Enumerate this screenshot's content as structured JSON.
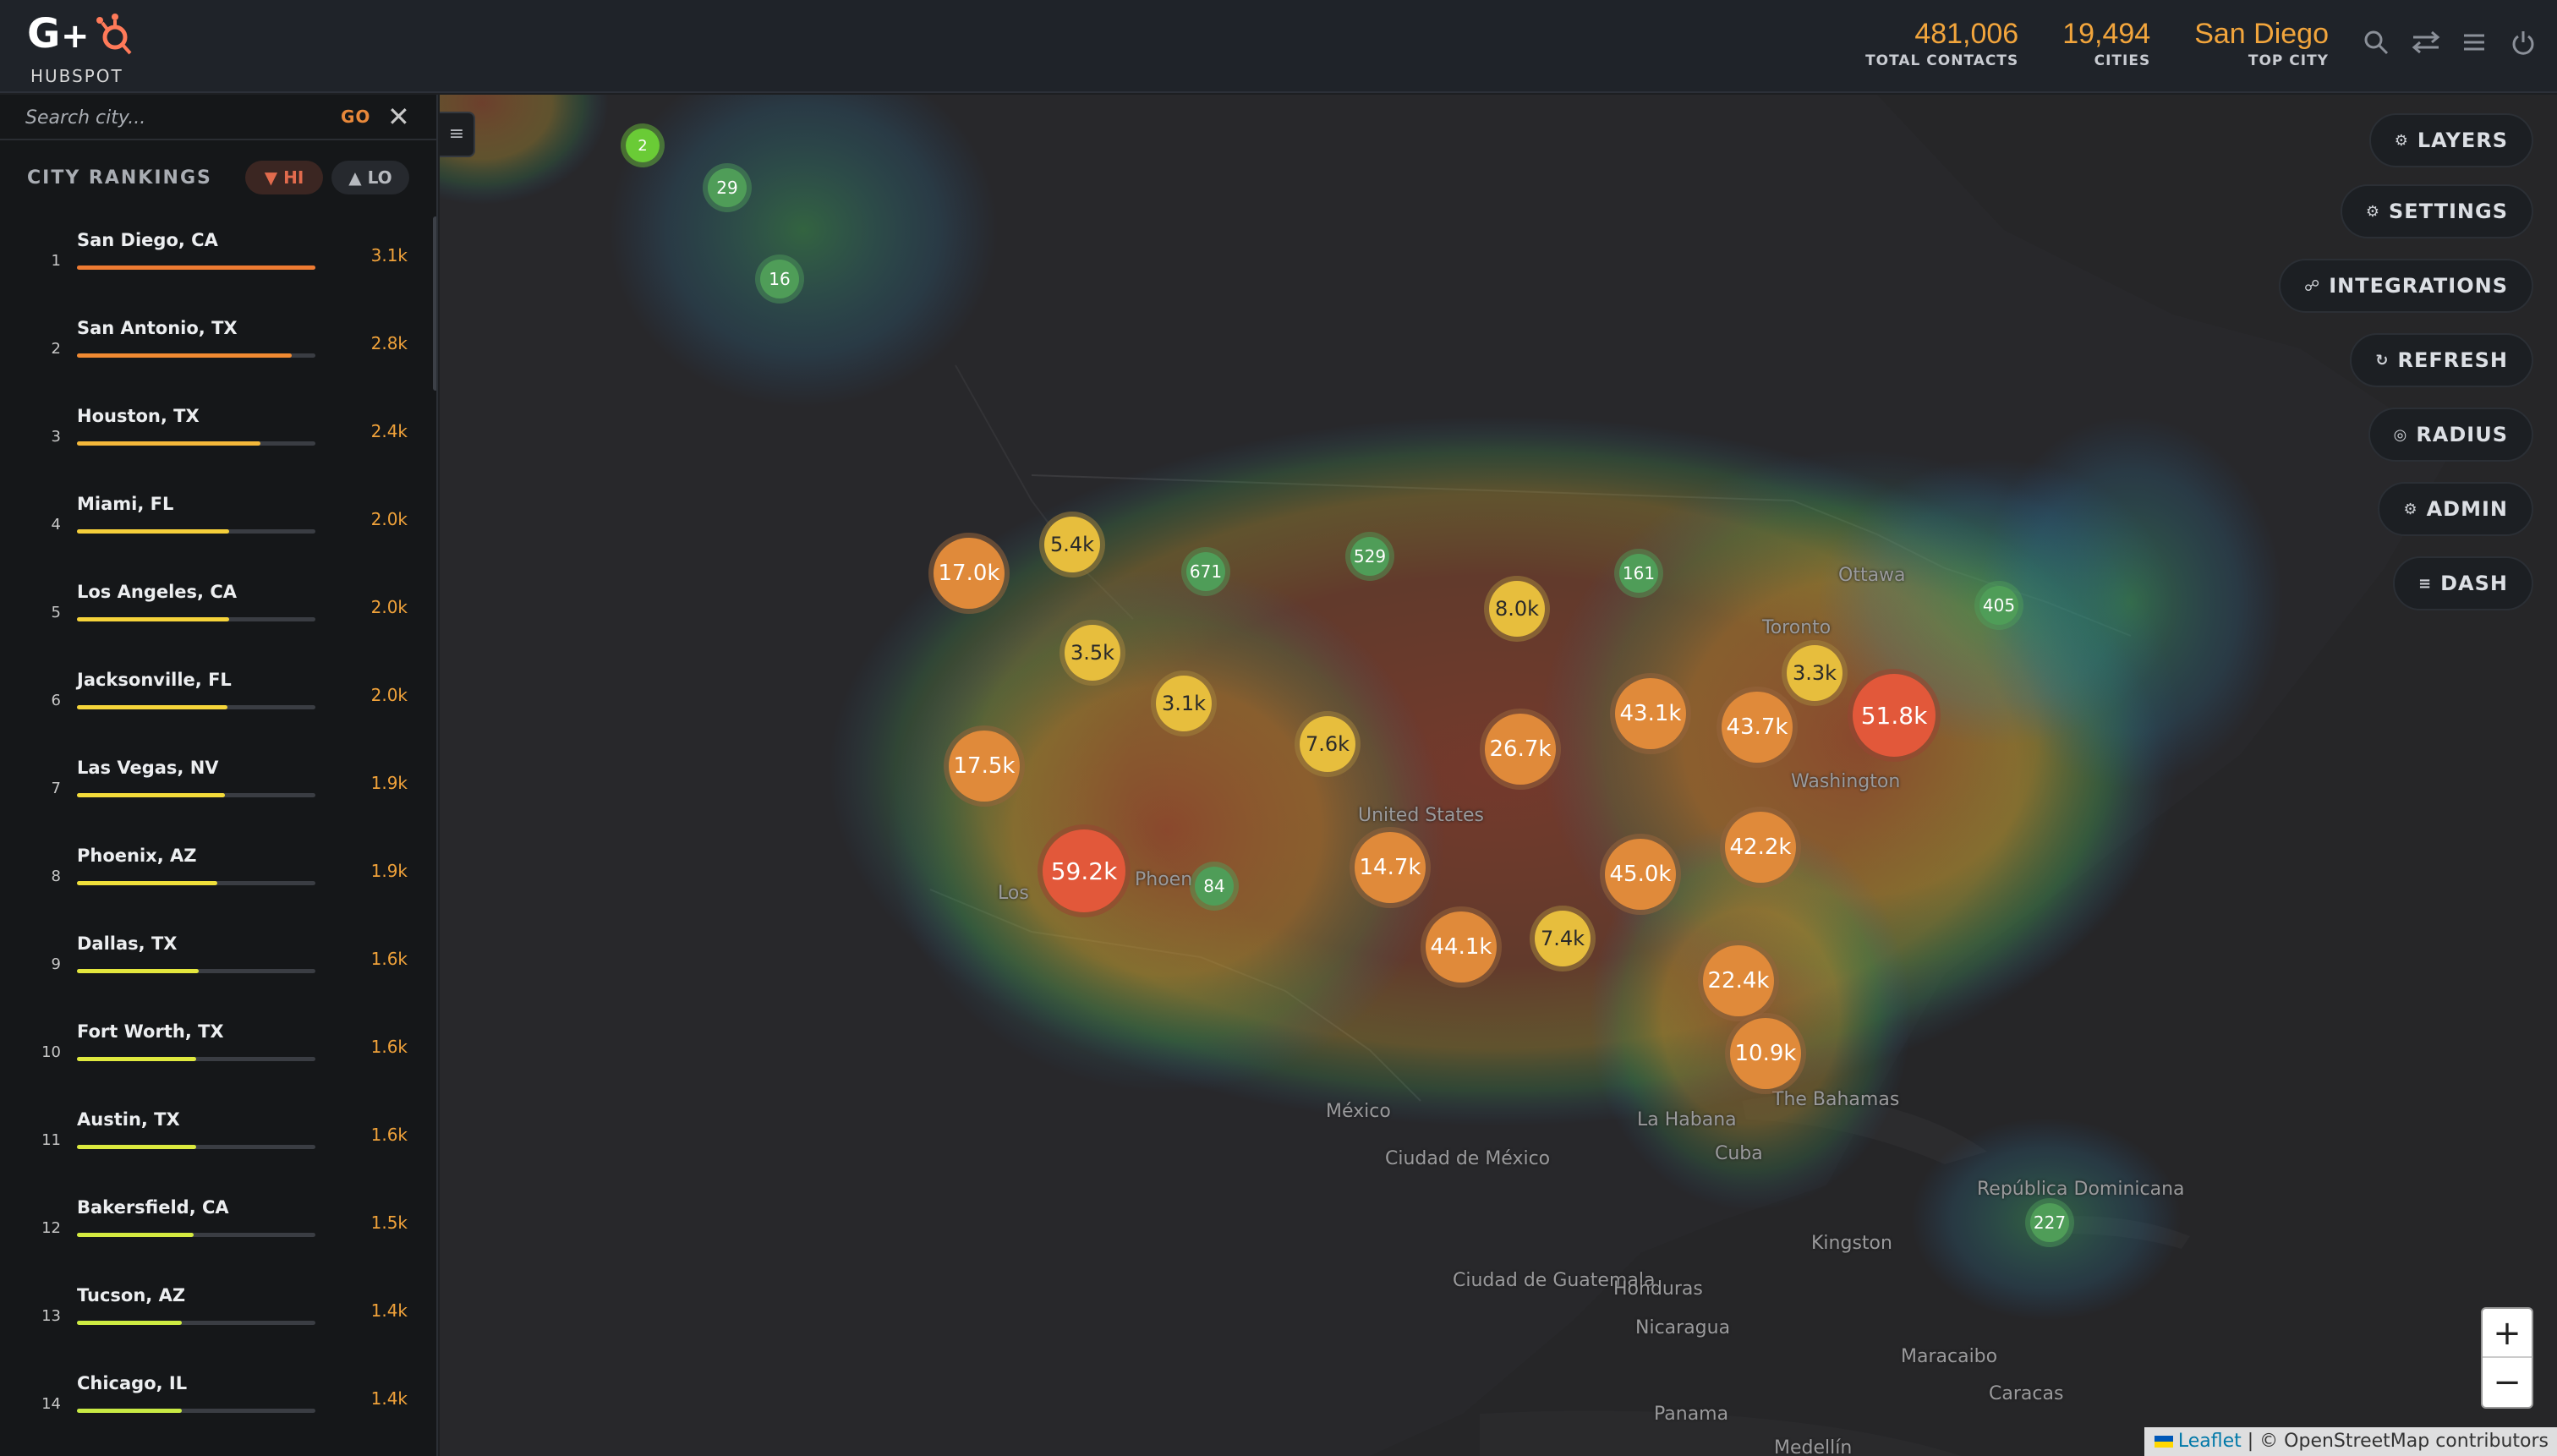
{
  "header": {
    "brand_text": "HUBSPOT",
    "logo_text": "G+",
    "stats": [
      {
        "value": "481,006",
        "label": "TOTAL CONTACTS"
      },
      {
        "value": "19,494",
        "label": "CITIES"
      },
      {
        "value": "San Diego",
        "label": "TOP CITY"
      }
    ],
    "icons": [
      "search-icon",
      "swap-icon",
      "menu-icon",
      "power-icon"
    ]
  },
  "sidebar": {
    "search": {
      "placeholder": "Search city...",
      "go_label": "GO",
      "clear_label": "✕"
    },
    "rankings_title": "CITY RANKINGS",
    "sort_hi_label": "▼ HI",
    "sort_lo_label": "▲ LO",
    "cities": [
      {
        "rank": "1",
        "name": "San Diego, CA",
        "value": "3.1k",
        "bar": 1.0,
        "color": "#ee7b32"
      },
      {
        "rank": "2",
        "name": "San Antonio, TX",
        "value": "2.8k",
        "bar": 0.9,
        "color": "#f08a32"
      },
      {
        "rank": "3",
        "name": "Houston, TX",
        "value": "2.4k",
        "bar": 0.77,
        "color": "#f4b83a"
      },
      {
        "rank": "4",
        "name": "Miami, FL",
        "value": "2.0k",
        "bar": 0.64,
        "color": "#f5cf3a"
      },
      {
        "rank": "5",
        "name": "Los Angeles, CA",
        "value": "2.0k",
        "bar": 0.64,
        "color": "#f5d33a"
      },
      {
        "rank": "6",
        "name": "Jacksonville, FL",
        "value": "2.0k",
        "bar": 0.63,
        "color": "#f5d53a"
      },
      {
        "rank": "7",
        "name": "Las Vegas, NV",
        "value": "1.9k",
        "bar": 0.62,
        "color": "#f3db3a"
      },
      {
        "rank": "8",
        "name": "Phoenix, AZ",
        "value": "1.9k",
        "bar": 0.59,
        "color": "#efdf3a"
      },
      {
        "rank": "9",
        "name": "Dallas, TX",
        "value": "1.6k",
        "bar": 0.51,
        "color": "#e3e63d"
      },
      {
        "rank": "10",
        "name": "Fort Worth, TX",
        "value": "1.6k",
        "bar": 0.5,
        "color": "#dfe93e"
      },
      {
        "rank": "11",
        "name": "Austin, TX",
        "value": "1.6k",
        "bar": 0.5,
        "color": "#dbe93e"
      },
      {
        "rank": "12",
        "name": "Bakersfield, CA",
        "value": "1.5k",
        "bar": 0.49,
        "color": "#d4ea40"
      },
      {
        "rank": "13",
        "name": "Tucson, AZ",
        "value": "1.4k",
        "bar": 0.44,
        "color": "#cdeb42"
      },
      {
        "rank": "14",
        "name": "Chicago, IL",
        "value": "1.4k",
        "bar": 0.44,
        "color": "#c8ea44"
      }
    ]
  },
  "map": {
    "collapse_icon": "≡",
    "controls": [
      {
        "name": "layers-button",
        "icon": "⚙",
        "label": "LAYERS"
      },
      {
        "name": "settings-button",
        "icon": "⚙",
        "label": "SETTINGS"
      },
      {
        "name": "integrations-button",
        "icon": "☍",
        "label": "INTEGRATIONS"
      },
      {
        "name": "refresh-button",
        "icon": "↻",
        "label": "REFRESH"
      },
      {
        "name": "radius-button",
        "icon": "◎",
        "label": "RADIUS"
      },
      {
        "name": "admin-button",
        "icon": "⚙",
        "label": "ADMIN"
      },
      {
        "name": "dash-button",
        "icon": "≡",
        "label": "DASH"
      }
    ],
    "zoom_in": "+",
    "zoom_out": "−",
    "attribution_leaflet": "Leaflet",
    "attribution_osm": " | © OpenStreetMap contributors",
    "place_labels": [
      "Ottawa",
      "Toronto",
      "Washington",
      "United States",
      "Los",
      "Phoen",
      "México",
      "Ciudad de México",
      "La Habana",
      "The Bahamas",
      "Cuba",
      "República Dominicana",
      "Kingston",
      "Ciudad de Guatemala",
      "Honduras",
      "Nicaragua",
      "Panama",
      "Maracaibo",
      "Caracas",
      "Medellín"
    ],
    "clusters": [
      {
        "label": "2",
        "tier": "small"
      },
      {
        "label": "29",
        "tier": "green"
      },
      {
        "label": "16",
        "tier": "green"
      },
      {
        "label": "17.0k",
        "tier": "orange"
      },
      {
        "label": "5.4k",
        "tier": "yellow"
      },
      {
        "label": "671",
        "tier": "green"
      },
      {
        "label": "529",
        "tier": "green"
      },
      {
        "label": "3.5k",
        "tier": "yellow"
      },
      {
        "label": "3.1k",
        "tier": "yellow"
      },
      {
        "label": "8.0k",
        "tier": "yellow"
      },
      {
        "label": "161",
        "tier": "green"
      },
      {
        "label": "405",
        "tier": "green"
      },
      {
        "label": "3.3k",
        "tier": "yellow"
      },
      {
        "label": "51.8k",
        "tier": "red"
      },
      {
        "label": "43.1k",
        "tier": "orange"
      },
      {
        "label": "43.7k",
        "tier": "orange"
      },
      {
        "label": "26.7k",
        "tier": "orange"
      },
      {
        "label": "7.6k",
        "tier": "yellow"
      },
      {
        "label": "17.5k",
        "tier": "orange"
      },
      {
        "label": "59.2k",
        "tier": "red"
      },
      {
        "label": "84",
        "tier": "green"
      },
      {
        "label": "14.7k",
        "tier": "orange"
      },
      {
        "label": "45.0k",
        "tier": "orange"
      },
      {
        "label": "42.2k",
        "tier": "orange"
      },
      {
        "label": "44.1k",
        "tier": "orange"
      },
      {
        "label": "7.4k",
        "tier": "yellow"
      },
      {
        "label": "22.4k",
        "tier": "orange"
      },
      {
        "label": "10.9k",
        "tier": "orange"
      },
      {
        "label": "227",
        "tier": "green"
      }
    ]
  }
}
